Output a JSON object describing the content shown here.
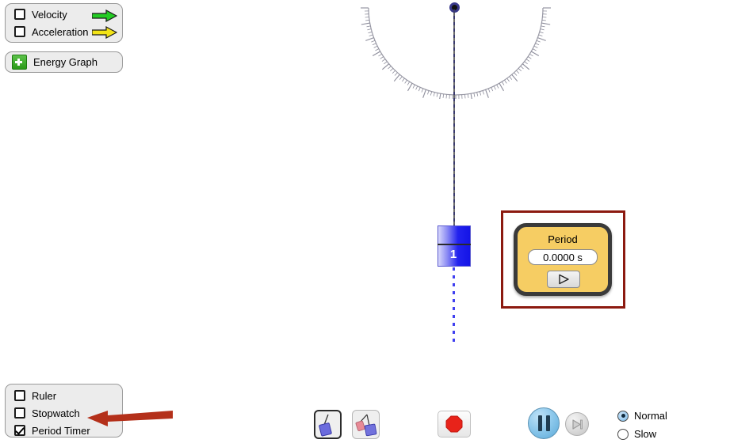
{
  "vectors_panel": {
    "items": [
      {
        "label": "Velocity",
        "checked": false,
        "arrow_icon": "green-arrow-icon",
        "arrow_color": "#22cc22"
      },
      {
        "label": "Acceleration",
        "checked": false,
        "arrow_icon": "yellow-arrow-icon",
        "arrow_color": "#f2e316"
      }
    ]
  },
  "energy_graph_button": {
    "label": "Energy Graph",
    "icon": "green-plus-icon",
    "icon_color": "#35a81f"
  },
  "tools_panel": {
    "items": [
      {
        "label": "Ruler",
        "checked": false
      },
      {
        "label": "Stopwatch",
        "checked": false
      },
      {
        "label": "Period Timer",
        "checked": true
      }
    ]
  },
  "pendulum": {
    "bob_number": "1",
    "bob_color": "#1f1fee",
    "pivot_icon": "pivot-point-icon",
    "string_icon": "pendulum-string"
  },
  "period_timer": {
    "title": "Period",
    "readout": "0.0000 s",
    "play_icon": "play-triangle-icon",
    "panel_color": "#f6cd63",
    "highlight_color": "#8c1a10"
  },
  "bottom_controls": {
    "pendulum_count_buttons": [
      {
        "name": "one-pendulum",
        "selected": true
      },
      {
        "name": "two-pendulums",
        "selected": false
      }
    ],
    "reset_button": {
      "icon": "red-octagon-stop-icon",
      "color": "#e8231a"
    },
    "pause_button": {
      "icon": "pause-icon",
      "color": "#8ec9ec"
    },
    "step_button": {
      "icon": "step-forward-icon",
      "color": "#dcdcdc"
    },
    "speed_options": [
      {
        "label": "Normal",
        "selected": true
      },
      {
        "label": "Slow",
        "selected": false
      }
    ]
  },
  "annotation": {
    "arrow_icon": "red-pointer-arrow",
    "color": "#b4301a"
  }
}
